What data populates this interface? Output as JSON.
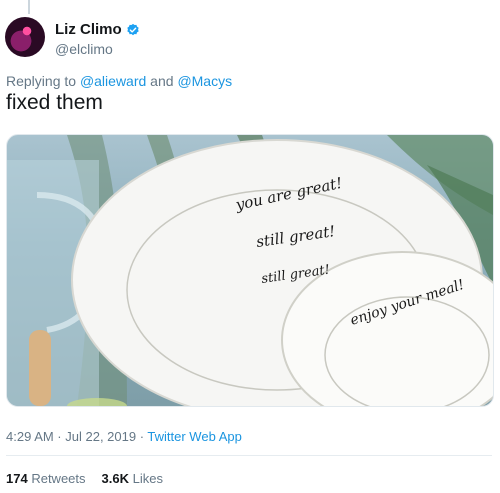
{
  "tweet": {
    "author_name": "Liz Climo",
    "author_handle": "@elclimo",
    "replying_prefix": "Replying to ",
    "replying_user1": "@alieward",
    "replying_and": " and ",
    "replying_user2": "@Macys",
    "text": "fixed them",
    "timestamp": "4:29 AM · Jul 22, 2019 · ",
    "source": "Twitter Web App",
    "retweets_count": "174",
    "retweets_label": "Retweets",
    "likes_count": "3.6K",
    "likes_label": "Likes"
  },
  "photo": {
    "plate_line1": "you are great!",
    "plate_line2": "still great!",
    "plate_line3": "still great!",
    "plate_line4": "enjoy your meal!"
  },
  "colors": {
    "link": "#1b95e0",
    "verified": "#1da1f2",
    "muted": "#657786"
  },
  "icons": [
    "verified-badge-icon"
  ]
}
